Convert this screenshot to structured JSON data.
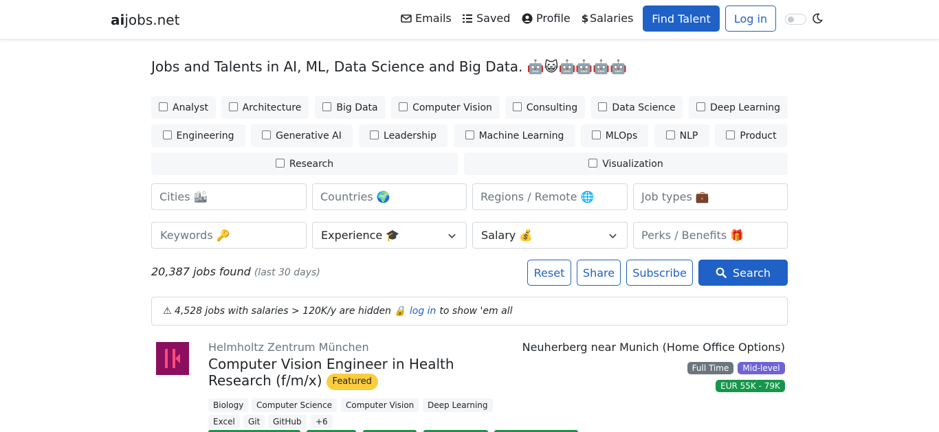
{
  "nav": {
    "brand_bold": "ai",
    "brand_rest": "jobs.net",
    "links": [
      "Emails",
      "Saved",
      "Profile",
      "Salaries"
    ],
    "find_talent": "Find Talent",
    "login": "Log in",
    "icons": [
      "envelope-icon",
      "list-icon",
      "user-circle-icon",
      "dollar-icon",
      "moon-icon"
    ]
  },
  "headline": "Jobs and Talents in AI, ML, Data Science and Big Data. 🤖😺🤖🤖🤖🤖",
  "categories": [
    "Analyst",
    "Architecture",
    "Big Data",
    "Computer Vision",
    "Consulting",
    "Data Science",
    "Deep Learning",
    "Engineering",
    "Generative AI",
    "Leadership",
    "Machine Learning",
    "MLOps",
    "NLP",
    "Product",
    "Research",
    "Visualization"
  ],
  "filters": {
    "cities": "Cities 🏙",
    "countries": "Countries 🌍",
    "regions": "Regions / Remote 🌐",
    "job_types": "Job types 💼",
    "keywords": "Keywords 🔑",
    "experience": "Experience 🎓",
    "salary": "Salary 💰",
    "perks": "Perks / Benefits 🎁"
  },
  "results": {
    "count": "20,387 jobs found",
    "period": "(last 30 days)",
    "reset": "Reset",
    "share": "Share",
    "subscribe": "Subscribe",
    "search": "Search"
  },
  "notice": {
    "before": "⚠ 4,528 jobs with salaries > 120K/y are hidden 🔒",
    "link": "log in",
    "after": "to show 'em all"
  },
  "job": {
    "company": "Helmholtz Zentrum München",
    "title": "Computer Vision Engineer in Health Research (f/m/x)",
    "featured": "Featured",
    "location": "Neuherberg near Munich (Home Office Options)",
    "type": "Full Time",
    "level": "Mid-level",
    "salary": "EUR 55K - 79K",
    "tags": [
      "Biology",
      "Computer Science",
      "Computer Vision",
      "Deep Learning",
      "Excel",
      "Git",
      "GitHub",
      "+6"
    ]
  },
  "colors": {
    "primary": "#1f61c6",
    "logo": "#8b0e5f",
    "featured": "#fbcd3c",
    "full_time": "#6c757d",
    "mid_level": "#6f63d6",
    "salary": "#17964b"
  }
}
